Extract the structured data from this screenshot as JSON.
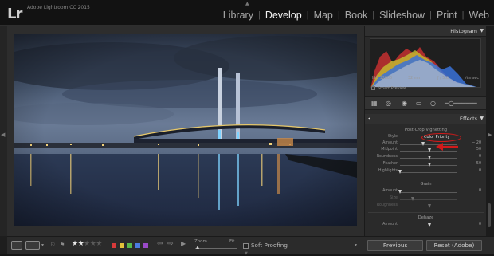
{
  "app": {
    "logo": "Lr",
    "name": "Adobe Lightroom CC 2015"
  },
  "modules": [
    {
      "label": "Library",
      "active": false
    },
    {
      "label": "Develop",
      "active": true
    },
    {
      "label": "Map",
      "active": false
    },
    {
      "label": "Book",
      "active": false
    },
    {
      "label": "Slideshow",
      "active": false
    },
    {
      "label": "Print",
      "active": false
    },
    {
      "label": "Web",
      "active": false
    }
  ],
  "histogram": {
    "title": "Histogram",
    "iso": "ISO 12800",
    "focal": "32 mm",
    "aperture": "ƒ / 5.6",
    "shutter": "¹⁄₁₀₀ sec",
    "smart_preview": "Smart Preview"
  },
  "effects": {
    "title": "Effects",
    "vignetting": {
      "title": "Post-Crop Vignetting",
      "style_label": "Style",
      "style_value": "Color Priority",
      "amount_label": "Amount",
      "amount": "− 20",
      "midpoint_label": "Midpoint",
      "midpoint": "50",
      "roundness_label": "Roundness",
      "roundness": "0",
      "feather_label": "Feather",
      "feather": "50",
      "highlights_label": "Highlights",
      "highlights": "0"
    },
    "grain": {
      "title": "Grain",
      "amount_label": "Amount",
      "amount": "0",
      "size_label": "Size",
      "size": "",
      "roughness_label": "Roughness",
      "roughness": ""
    },
    "dehaze": {
      "title": "Dehaze",
      "amount_label": "Amount",
      "amount": "0"
    }
  },
  "toolbar": {
    "rating": 2,
    "rating_max": 5,
    "color_labels": [
      "#d83a3a",
      "#e3c23a",
      "#57b84a",
      "#4a7be0",
      "#9a4ac9"
    ],
    "zoom_label": "Zoom",
    "fit_label": "Fit",
    "soft_proofing": "Soft Proofing"
  },
  "panel_buttons": {
    "previous": "Previous",
    "reset": "Reset (Adobe)"
  },
  "colors": {
    "accent_red": "#d11a1a",
    "panel_bg": "#2a2a2a"
  }
}
